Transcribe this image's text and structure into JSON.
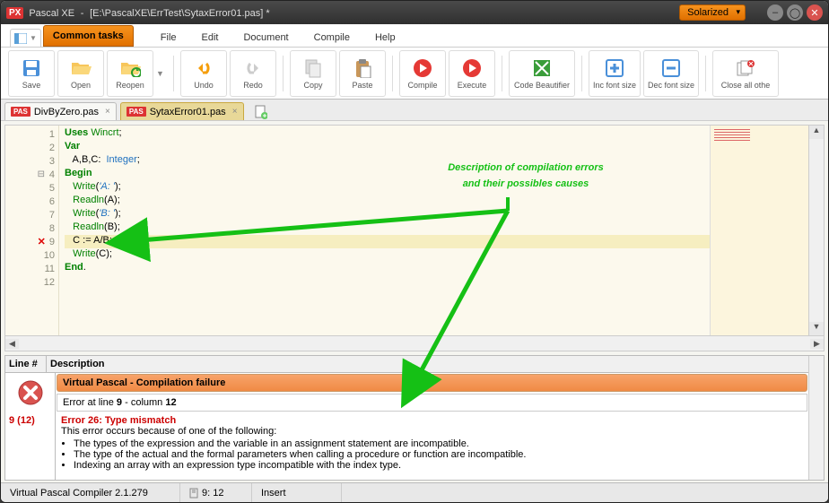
{
  "window": {
    "app": "Pascal XE",
    "sep": "-",
    "doc": "[E:\\PascalXE\\ErrTest\\SytaxError01.pas] *",
    "theme": "Solarized"
  },
  "menu": {
    "common": "Common tasks",
    "file": "File",
    "edit": "Edit",
    "document": "Document",
    "compile": "Compile",
    "help": "Help"
  },
  "ribbon": {
    "save": "Save",
    "open": "Open",
    "reopen": "Reopen",
    "undo": "Undo",
    "redo": "Redo",
    "copy": "Copy",
    "paste": "Paste",
    "compile": "Compile",
    "execute": "Execute",
    "beautifier": "Code Beautifier",
    "incfont": "Inc font size",
    "decfont": "Dec font size",
    "closeall": "Close all othe"
  },
  "tabs": {
    "t1": "DivByZero.pas",
    "t2": "SytaxError01.pas"
  },
  "code": {
    "l1a": "Uses",
    "l1b": " Wincrt",
    "l1c": ";",
    "l2": "Var",
    "l3a": "   A",
    "l3b": ",",
    "l3c": "B",
    "l3d": ",",
    "l3e": "C",
    "l3f": ":  ",
    "l3g": "Integer",
    "l3h": ";",
    "l4": "Begin",
    "l5a": "   Write",
    "l5b": "(",
    "l5c": "'A: '",
    "l5d": ");",
    "l6a": "   Readln",
    "l6b": "(A);",
    "l7a": "   Write",
    "l7b": "(",
    "l7c": "'B: '",
    "l7d": ");",
    "l8a": "   Readln",
    "l8b": "(B);",
    "l9a": "   C ",
    "l9b": ":=",
    "l9c": " A",
    "l9d": "/",
    "l9e": "B",
    "l9f": ";",
    "l10a": "   Write",
    "l10b": "(C);",
    "l11": "End",
    "l11b": "."
  },
  "annotation": {
    "line1": "Description of compilation errors",
    "line2": "and their possibles causes"
  },
  "errtable": {
    "h_line": "Line #",
    "h_desc": "Description",
    "fail": "Virtual Pascal - Compilation failure",
    "at1": "Error at line ",
    "at2": "9",
    "at3": " - column ",
    "at4": "12",
    "ln": "9 (12)",
    "etitle": "Error 26: Type mismatch",
    "edesc": "This error occurs because of one of the following:",
    "b1": "The types of the expression and the variable in an assignment statement are incompatible.",
    "b2": "The type of the actual and the formal parameters when calling a procedure or function are incompatible.",
    "b3": "Indexing an array with an expression type incompatible with the index type."
  },
  "status": {
    "compiler": "Virtual Pascal Compiler 2.1.279",
    "pos": "9: 12",
    "mode": "Insert"
  }
}
